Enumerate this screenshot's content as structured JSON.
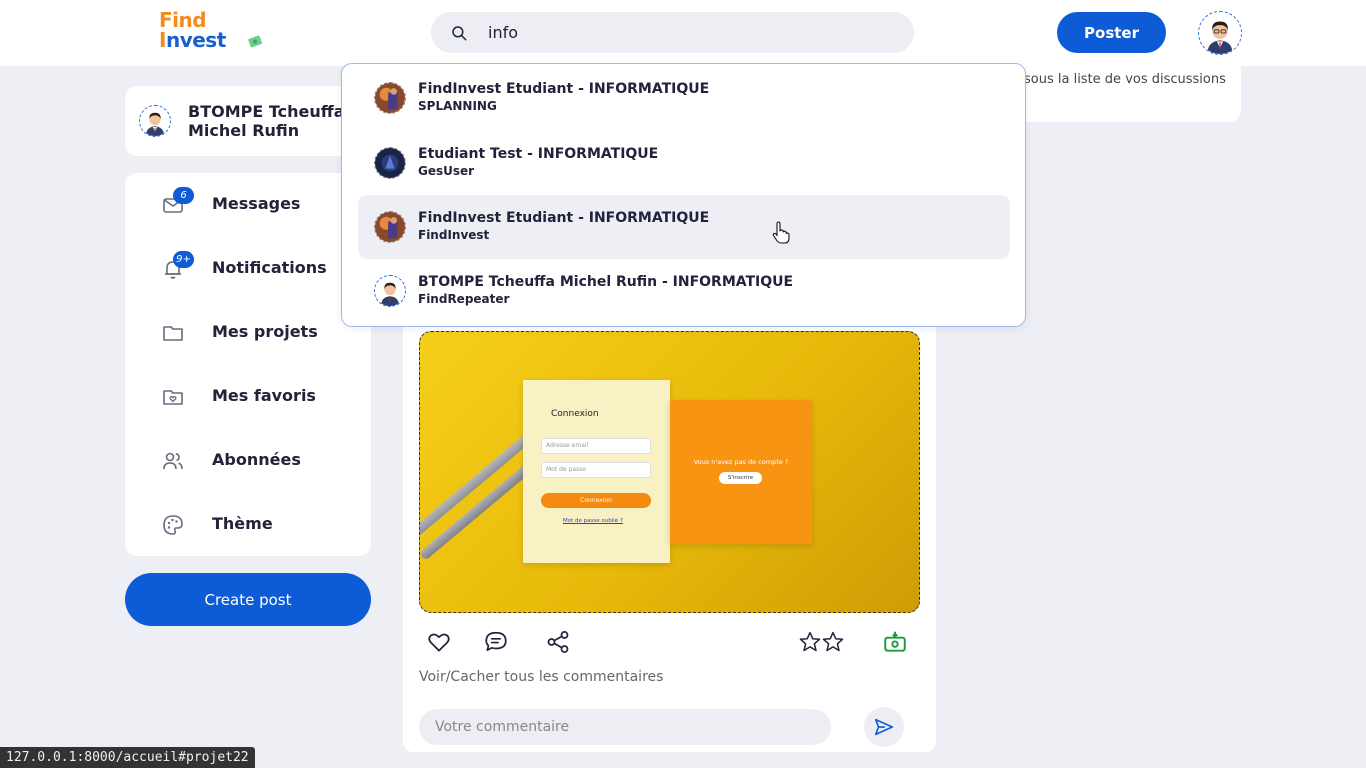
{
  "app": {
    "logo_line1": "Find",
    "logo_line2_first": "I",
    "logo_line2_rest": "nvest"
  },
  "search": {
    "value": "info",
    "placeholder": ""
  },
  "header": {
    "poster_label": "Poster"
  },
  "profile": {
    "name": "BTOMPE Tcheuffa Michel Rufin"
  },
  "menu": [
    {
      "label": "Messages",
      "icon": "mail-icon",
      "badge": "6"
    },
    {
      "label": "Notifications",
      "icon": "bell-icon",
      "badge": "9+"
    },
    {
      "label": "Mes projets",
      "icon": "folder-icon",
      "badge": ""
    },
    {
      "label": "Mes favoris",
      "icon": "heart-folder-icon",
      "badge": ""
    },
    {
      "label": "Abonnées",
      "icon": "users-icon",
      "badge": ""
    },
    {
      "label": "Thème",
      "icon": "palette-icon",
      "badge": ""
    }
  ],
  "create_post_label": "Create post",
  "right_panel": {
    "text": "sous la liste de vos discussions"
  },
  "dropdown": {
    "results": [
      {
        "title": "FindInvest Etudiant - INFORMATIQUE",
        "subtitle": "SPLANNING"
      },
      {
        "title": "Etudiant Test - INFORMATIQUE",
        "subtitle": "GesUser"
      },
      {
        "title": "FindInvest Etudiant - INFORMATIQUE",
        "subtitle": "FindInvest",
        "hovered": true
      },
      {
        "title": "BTOMPE Tcheuffa Michel Rufin - INFORMATIQUE",
        "subtitle": "FindRepeater"
      }
    ]
  },
  "post": {
    "image": {
      "login_title": "Connexion",
      "email_placeholder": "Adresse email",
      "password_placeholder": "Mot de passe",
      "login_button": "Connexion",
      "forgot_link": "Mot de passe oublié ?",
      "no_account_text": "Vous n'avez pas de compte ?",
      "signup_button": "S'inscrire"
    },
    "toggle_comments": "Voir/Cacher tous les commentaires",
    "comment_placeholder": "Votre commentaire"
  },
  "status_bar": {
    "url": "127.0.0.1:8000/accueil#projet22"
  },
  "colors": {
    "accent": "#0d5bd6",
    "background": "#eeeef5",
    "logo_orange": "#f28c1e"
  }
}
